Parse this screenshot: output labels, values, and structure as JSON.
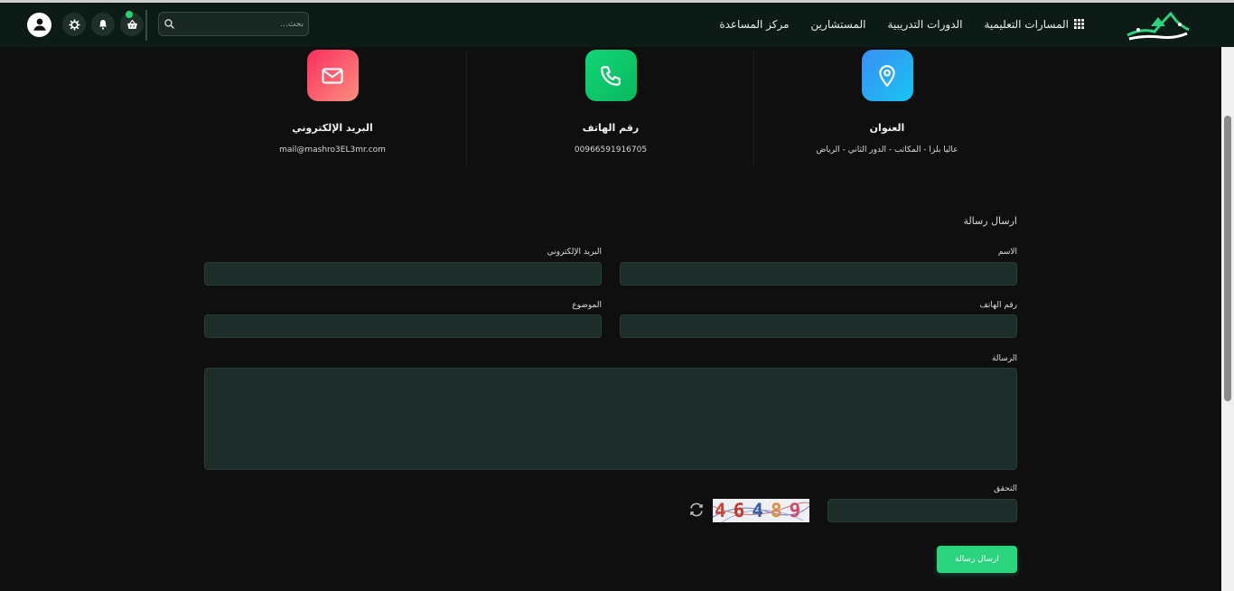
{
  "nav": {
    "links": [
      "المسارات التعليمية",
      "الدورات التدريبية",
      "المستشارين",
      "مركز المساعدة"
    ],
    "search_placeholder": "بحث..."
  },
  "contact_info": [
    {
      "title": "العنوان",
      "value": "عاليا بلزا - المكاتب - الدور الثاني - الرياض"
    },
    {
      "title": "رقم الهاتف",
      "value": "00966591916705"
    },
    {
      "title": "البريد الإلكتروني",
      "value": "mail@mashro3EL3mr.com"
    }
  ],
  "form": {
    "title": "ارسال رسالة",
    "name_label": "الاسم",
    "email_label": "البريد الإلكتروني",
    "phone_label": "رقم الهاتف",
    "subject_label": "الموضوع",
    "message_label": "الرسالة",
    "verify_label": "التحقق",
    "captcha_digits": [
      "4",
      "6",
      "4",
      "8",
      "9"
    ],
    "submit_label": "ارسال رسالة"
  },
  "colors": {
    "navbar": "#0d1b17",
    "accent": "#2bd47f",
    "field_bg": "#1d2d29"
  }
}
